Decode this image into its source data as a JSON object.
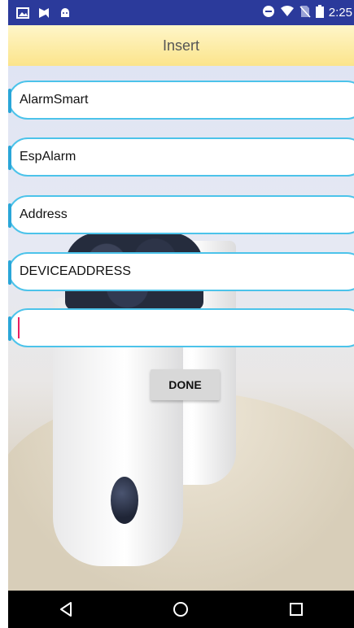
{
  "status_bar": {
    "time": "2:25",
    "left_icons": [
      "image-icon",
      "cast-icon",
      "android-icon"
    ],
    "right_icons": [
      "do-not-disturb-icon",
      "wifi-icon",
      "no-sim-icon",
      "battery-icon"
    ]
  },
  "app_bar": {
    "title": "Insert"
  },
  "form": {
    "fields": [
      {
        "value": "AlarmSmart"
      },
      {
        "value": "EspAlarm"
      },
      {
        "value": "Address"
      },
      {
        "value": "DEVICEADDRESS"
      },
      {
        "value": ""
      }
    ],
    "done_label": "DONE"
  },
  "nav_bar": {
    "buttons": [
      "back-icon",
      "home-icon",
      "recents-icon"
    ]
  },
  "colors": {
    "status_bar": "#2b3a9b",
    "field_border": "#4cc3ea",
    "cursor": "#e91e63"
  }
}
